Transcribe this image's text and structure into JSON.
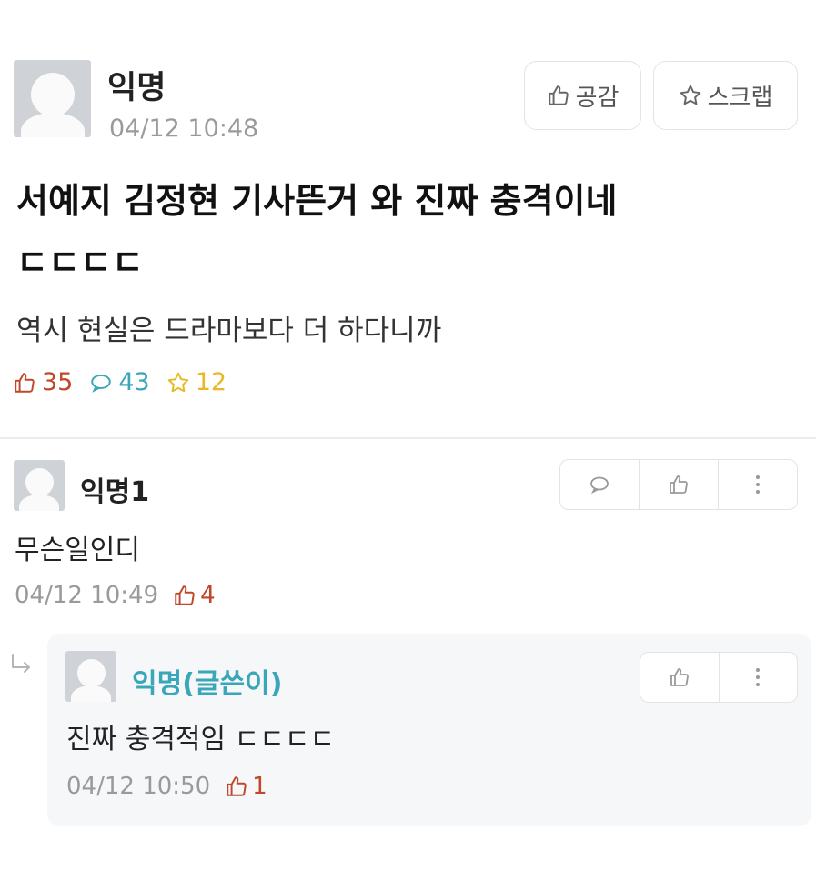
{
  "post": {
    "author": "익명",
    "timestamp": "04/12 10:48",
    "like_button_label": "공감",
    "scrap_button_label": "스크랩",
    "title_line1": "서예지 김정현 기사뜬거 와 진짜 충격이네",
    "title_line2": "ㄷㄷㄷㄷ",
    "body": "역시 현실은 드라마보다 더 하다니까",
    "stats": {
      "likes": "35",
      "comments": "43",
      "scraps": "12"
    }
  },
  "comment": {
    "author": "익명1",
    "text": "무슨일인디",
    "timestamp": "04/12 10:49",
    "likes": "4"
  },
  "reply": {
    "author": "익명(글쓴이)",
    "text": "진짜 충격적임 ㄷㄷㄷㄷ",
    "timestamp": "04/12 10:50",
    "likes": "1"
  },
  "colors": {
    "like": "#c0472a",
    "comment": "#3aa6b9",
    "scrap": "#e8b923",
    "author_op": "#3aa6b9",
    "meta": "#9a9a9a"
  },
  "icons": {
    "like": "thumbs-up-icon",
    "comment": "speech-bubble-icon",
    "scrap": "star-icon",
    "more": "vertical-dots-icon",
    "reply": "reply-arrow-icon"
  }
}
